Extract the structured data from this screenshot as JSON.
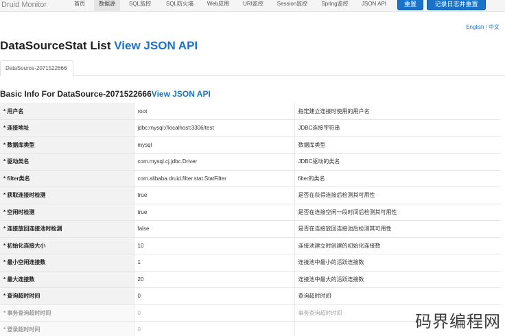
{
  "navbar": {
    "brand": "Druid Monitor",
    "items": [
      "首页",
      "数据源",
      "SQL监控",
      "SQL防火墙",
      "Web应用",
      "URI监控",
      "Session监控",
      "Spring监控",
      "JSON API"
    ],
    "reset_label": "重置",
    "log_reset_label": "记录日志并重置"
  },
  "lang": {
    "english": "English",
    "separator": "|",
    "chinese": "中文"
  },
  "page": {
    "title_prefix": "DataSourceStat List ",
    "title_link": "View JSON API"
  },
  "tab": {
    "label": "DataSource-2071522666"
  },
  "section": {
    "title_prefix": "Basic Info For DataSource-2071522666",
    "title_link": "View JSON API"
  },
  "rows": [
    {
      "key": "* 用户名",
      "value": "root",
      "desc": "指定建立连接时使用的用户名"
    },
    {
      "key": "* 连接地址",
      "value": "jdbc:mysql://localhost:3306/test",
      "desc": "JDBC连接字符串"
    },
    {
      "key": "* 数据库类型",
      "value": "mysql",
      "desc": "数据库类型"
    },
    {
      "key": "* 驱动类名",
      "value": "com.mysql.cj.jdbc.Driver",
      "desc": "JDBC驱动的类名"
    },
    {
      "key": "* filter类名",
      "value": "com.alibaba.druid.filter.stat.StatFilter",
      "desc": "filter的类名"
    },
    {
      "key": "* 获取连接时检测",
      "value": "true",
      "desc": "是否在获得连接后检测其可用性"
    },
    {
      "key": "* 空闲时检测",
      "value": "true",
      "desc": "是否在连接空闲一段时间后检测其可用性"
    },
    {
      "key": "* 连接放回连接池时检测",
      "value": "false",
      "desc": "是否在连接放回连接池后检测其可用性"
    },
    {
      "key": "* 初始化连接大小",
      "value": "10",
      "desc": "连接池建立时创建的初始化连接数"
    },
    {
      "key": "* 最小空闲连接数",
      "value": "1",
      "desc": "连接池中最小的活跃连接数"
    },
    {
      "key": "* 最大连接数",
      "value": "20",
      "desc": "连接池中最大的活跃连接数"
    },
    {
      "key": "* 查询超时时间",
      "value": "0",
      "desc": "查询超时时间"
    },
    {
      "key": "* 事务查询超时时间",
      "value": "0",
      "desc": "事务查询超时时间"
    },
    {
      "key": "* 登录超时时间",
      "value": "0",
      "desc": ""
    }
  ],
  "watermark": "码界编程网"
}
